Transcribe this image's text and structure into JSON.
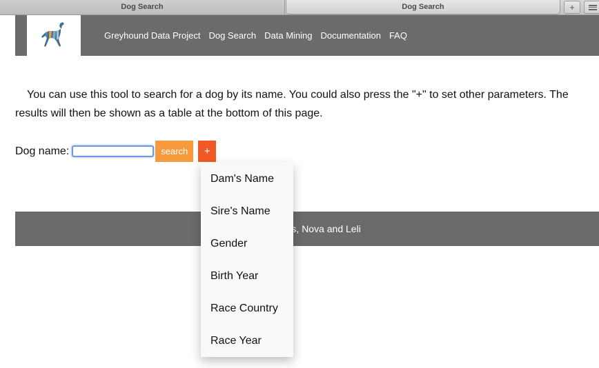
{
  "browser": {
    "tabs": [
      {
        "label": "Dog Search"
      },
      {
        "label": "Dog Search"
      }
    ],
    "new_tab_glyph": "+"
  },
  "header": {
    "logo_icon": "greyhound-logo-icon",
    "nav": [
      {
        "label": "Greyhound Data Project"
      },
      {
        "label": "Dog Search"
      },
      {
        "label": "Data Mining"
      },
      {
        "label": "Documentation"
      },
      {
        "label": "FAQ"
      }
    ]
  },
  "intro": {
    "text": "You can use this tool to search for a dog by its name. You could also press the \"+\" to set other parameters. The results will then be shown as a table at the bottom of this page."
  },
  "search": {
    "label": "Dog name:",
    "value": "",
    "search_button": "search",
    "plus_button": "+"
  },
  "dropdown": {
    "items": [
      {
        "label": "Dam's Name"
      },
      {
        "label": "Sire's Name"
      },
      {
        "label": "Gender"
      },
      {
        "label": "Birth Year"
      },
      {
        "label": "Race Country"
      },
      {
        "label": "Race Year"
      }
    ]
  },
  "footer": {
    "text": "y Ferdous, Nova and Leli"
  },
  "colors": {
    "header_bg": "#6b6b6b",
    "search_button": "#f79a3e",
    "plus_button": "#f15a24"
  }
}
